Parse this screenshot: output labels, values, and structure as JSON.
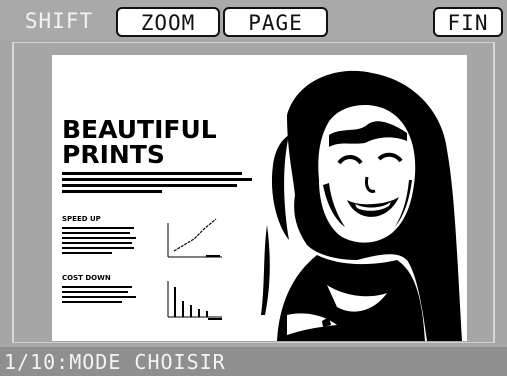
{
  "toolbar": {
    "shift_label": "SHIFT",
    "zoom_label": "ZOOM",
    "page_label": "PAGE",
    "fin_label": "FIN"
  },
  "preview": {
    "title_line1": "BEAUTIFUL",
    "title_line2": "PRINTS",
    "section1_heading": "SPEED UP",
    "section2_heading": "COST DOWN"
  },
  "status": {
    "text": "1/10:MODE CHOISIR"
  },
  "colors": {
    "background": "#a6a6a6",
    "status_bar": "#8f8f8f",
    "active_button": "#ffffff"
  }
}
